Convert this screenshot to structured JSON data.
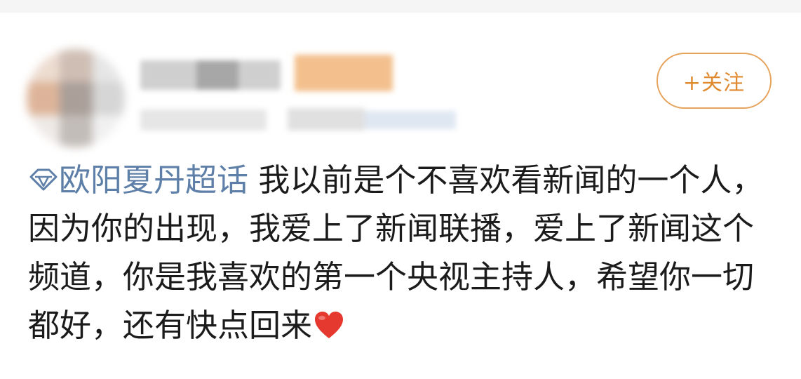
{
  "follow_button": {
    "label": "+关注"
  },
  "post": {
    "topic_label": "欧阳夏丹超话",
    "body_text": "我以前是个不喜欢看新闻的一个人，因为你的出现，我爱上了新闻联播，爱上了新闻这个频道，你是我喜欢的第一个央视主持人，希望你一切都好，还有快点回来",
    "emoji": "red-heart-icon"
  },
  "colors": {
    "topic_link": "#5d7fa8",
    "follow_accent": "#e08a30",
    "text": "#1b1b1b"
  }
}
